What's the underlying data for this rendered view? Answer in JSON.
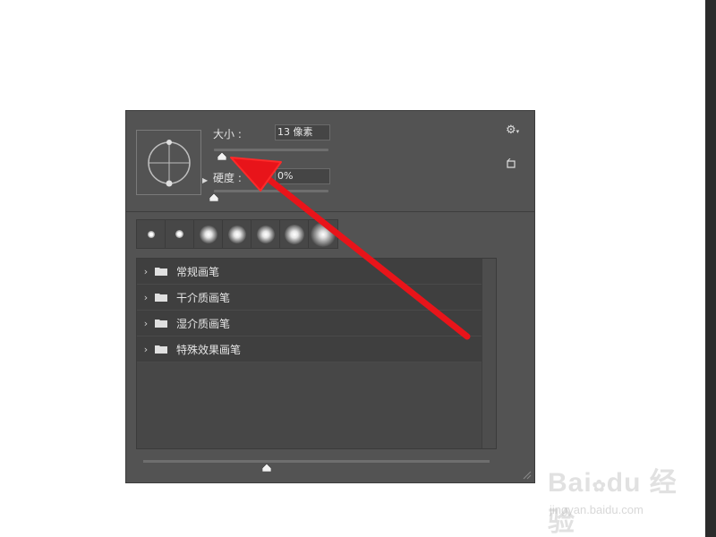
{
  "brush_panel": {
    "size": {
      "label": "大小 :",
      "value": "13 像素",
      "slider_percent": 3
    },
    "hardness": {
      "label": "硬度 :",
      "value": "0%",
      "slider_percent": 0
    },
    "presets": [
      {
        "name": "preset-1"
      },
      {
        "name": "preset-2"
      },
      {
        "name": "preset-3"
      },
      {
        "name": "preset-4"
      },
      {
        "name": "preset-5"
      },
      {
        "name": "preset-6"
      },
      {
        "name": "preset-7"
      }
    ],
    "folders": [
      {
        "label": "常规画笔"
      },
      {
        "label": "干介质画笔"
      },
      {
        "label": "湿介质画笔"
      },
      {
        "label": "特殊效果画笔"
      }
    ],
    "icons": {
      "settings": "gear-icon",
      "new_preset": "new-preset-icon",
      "folder": "folder-icon",
      "chevron": "chevron-right-icon"
    },
    "preview_size_percent": 30
  },
  "colors": {
    "panel": "#535353",
    "annotation_arrow": "#e8141a"
  },
  "watermark": {
    "logo": "Bai du 经验",
    "sub": "jingyan.baidu.com"
  }
}
